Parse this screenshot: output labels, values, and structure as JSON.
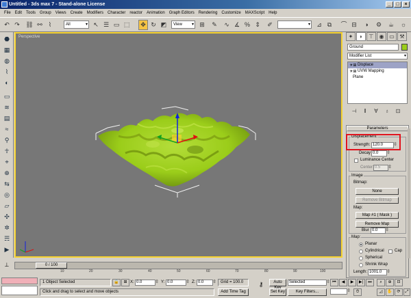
{
  "window": {
    "title": "Untitled - 3ds max 7 - Stand-alone License"
  },
  "menu": [
    "File",
    "Edit",
    "Tools",
    "Group",
    "Views",
    "Create",
    "Modifiers",
    "Character",
    "reactor",
    "Animation",
    "Graph Editors",
    "Rendering",
    "Customize",
    "MAXScript",
    "Help"
  ],
  "toolbar": {
    "selection_filter": "All",
    "ref_coord": "View"
  },
  "viewport": {
    "label": "Perspective"
  },
  "command_panel": {
    "object_name": "Ground",
    "object_color": "#9bcd1a",
    "modifier_list": "Modifier List",
    "stack": [
      "Displace",
      "UVW Mapping",
      "Plane"
    ],
    "rollout_title": "Parameters",
    "displacement": {
      "title": "Displacement:",
      "strength_label": "Strength:",
      "strength_value": "120.0",
      "decay_label": "Decay",
      "decay_value": "0.0",
      "luminance_label": "Luminance Center",
      "center_label": "Center:",
      "center_value": "0.5"
    },
    "image": {
      "title": "Image",
      "bitmap_label": "Bitmap:",
      "bitmap_button": "None",
      "remove_bitmap": "Remove Bitmap",
      "map_label": "Map:",
      "map_button": "Map #1 ( Mask )",
      "remove_map": "Remove Map",
      "blur_label": "Blur",
      "blur_value": "0.0"
    },
    "map": {
      "title": "Map:",
      "options": [
        "Planar",
        "Cylindrical",
        "Spherical",
        "Shrink Wrap"
      ],
      "selected": "Planar",
      "cap_label": "Cap",
      "length_label": "Length:",
      "length_value": "1001.0"
    }
  },
  "timeline": {
    "frame_display": "0 / 100",
    "ticks": [
      "10",
      "20",
      "30",
      "40",
      "50",
      "60",
      "70",
      "80",
      "90",
      "100"
    ]
  },
  "status": {
    "selection": "1 Object Selected",
    "prompt": "Click and drag to select and move objects",
    "x_label": "X:",
    "x_value": "0.0",
    "y_label": "Y:",
    "y_value": "0.0",
    "z_label": "Z:",
    "z_value": "0.0",
    "grid": "Grid = 100.0",
    "add_time_tag": "Add Time Tag",
    "auto_key": "Auto Key",
    "auto_key_value": "Selected",
    "set_key": "Set Key",
    "key_filters": "Key Filters..."
  },
  "colors": {
    "viewport_bg": "#777777",
    "active_border": "#f7d330",
    "terrain": "#9bcd1a",
    "highlight": "#e0141e"
  }
}
